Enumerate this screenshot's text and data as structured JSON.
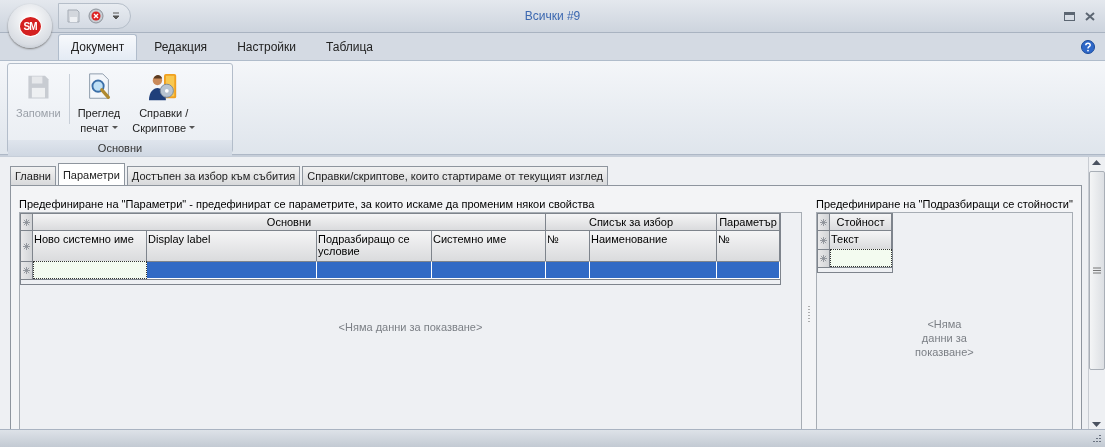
{
  "window": {
    "title": "Всички #9",
    "logo": "SM"
  },
  "ribbon": {
    "tabs": [
      {
        "label": "Документ",
        "selected": true
      },
      {
        "label": "Редакция",
        "selected": false
      },
      {
        "label": "Настройки",
        "selected": false
      },
      {
        "label": "Таблица",
        "selected": false
      }
    ],
    "groups": [
      {
        "label": "Основни",
        "buttons": [
          {
            "label": "Запомни",
            "disabled": true,
            "dropdown": false
          },
          {
            "label": "Преглед\nпечат",
            "disabled": false,
            "dropdown": true
          },
          {
            "label": "Справки /\nСкриптове",
            "disabled": false,
            "dropdown": true
          }
        ]
      }
    ]
  },
  "tabs": [
    {
      "label": "Главни",
      "selected": false
    },
    {
      "label": "Параметри",
      "selected": true
    },
    {
      "label": "Достъпен за избор към събития",
      "selected": false
    },
    {
      "label": "Справки/скриптове, които стартираме от текущият изглед",
      "selected": false
    }
  ],
  "parameters_grid": {
    "caption": "Предефиниране на \"Параметри\" - предефинират се параметрите, за които искаме да променим някои свойства",
    "bands": [
      {
        "label": "Основни",
        "columns": [
          "Ново системно име",
          "Display label",
          "Подразбиращо се условие",
          "Системно име"
        ]
      },
      {
        "label": "Списък за избор",
        "columns": [
          "№",
          "Наименование"
        ]
      },
      {
        "label": "Параметър",
        "columns": [
          "№"
        ]
      }
    ],
    "new_row": {
      "selected": true
    },
    "empty_text": "<Няма данни за показване>"
  },
  "defaults_grid": {
    "caption": "Предефиниране на \"Подразбиращи се стойности\"",
    "bands": [
      {
        "label": "Стойност",
        "columns": [
          "Текст"
        ]
      }
    ],
    "empty_text": "<Няма данни за показване>"
  }
}
